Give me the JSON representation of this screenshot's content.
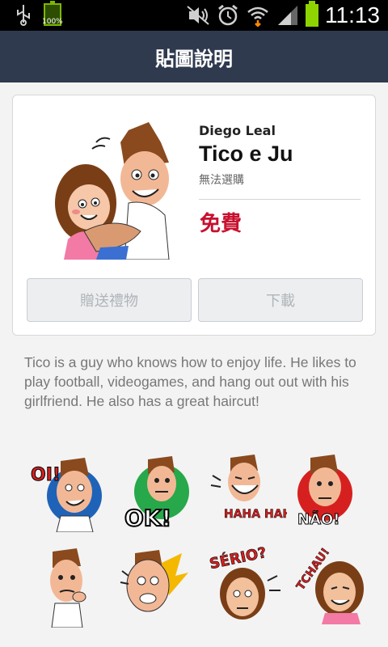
{
  "status_bar": {
    "battery_small_pct": "100%",
    "time": "11:13",
    "icons": [
      "usb-icon",
      "battery-icon",
      "mute-icon",
      "alarm-icon",
      "wifi-icon",
      "signal-icon",
      "battery-full-icon"
    ]
  },
  "header": {
    "title": "貼圖說明"
  },
  "package": {
    "author": "Diego Leal",
    "title": "Tico e Ju",
    "note": "無法選購",
    "price": "免費",
    "gift_label": "贈送禮物",
    "download_label": "下載"
  },
  "description": "Tico is a guy who knows how to enjoy life. He likes to play football, videogames, and hang out out with his girlfriend. He also has a great haircut!",
  "stickers": [
    {
      "text": "OI!",
      "accent": "#1e63b8"
    },
    {
      "text": "OK!",
      "accent": "#27a84a"
    },
    {
      "text": "HAHA HAHA!",
      "accent": "#d62020"
    },
    {
      "text": "NÃO!",
      "accent": "#d62020"
    },
    {
      "text": "",
      "accent": "#ffffff"
    },
    {
      "text": "",
      "accent": "#f5b800"
    },
    {
      "text": "SÉRIO?",
      "accent": "#d62020"
    },
    {
      "text": "TCHAU!",
      "accent": "#d62020"
    }
  ],
  "colors": {
    "header_bg": "#2f3a4f",
    "price": "#c8102e",
    "background": "#f3f3f3"
  }
}
